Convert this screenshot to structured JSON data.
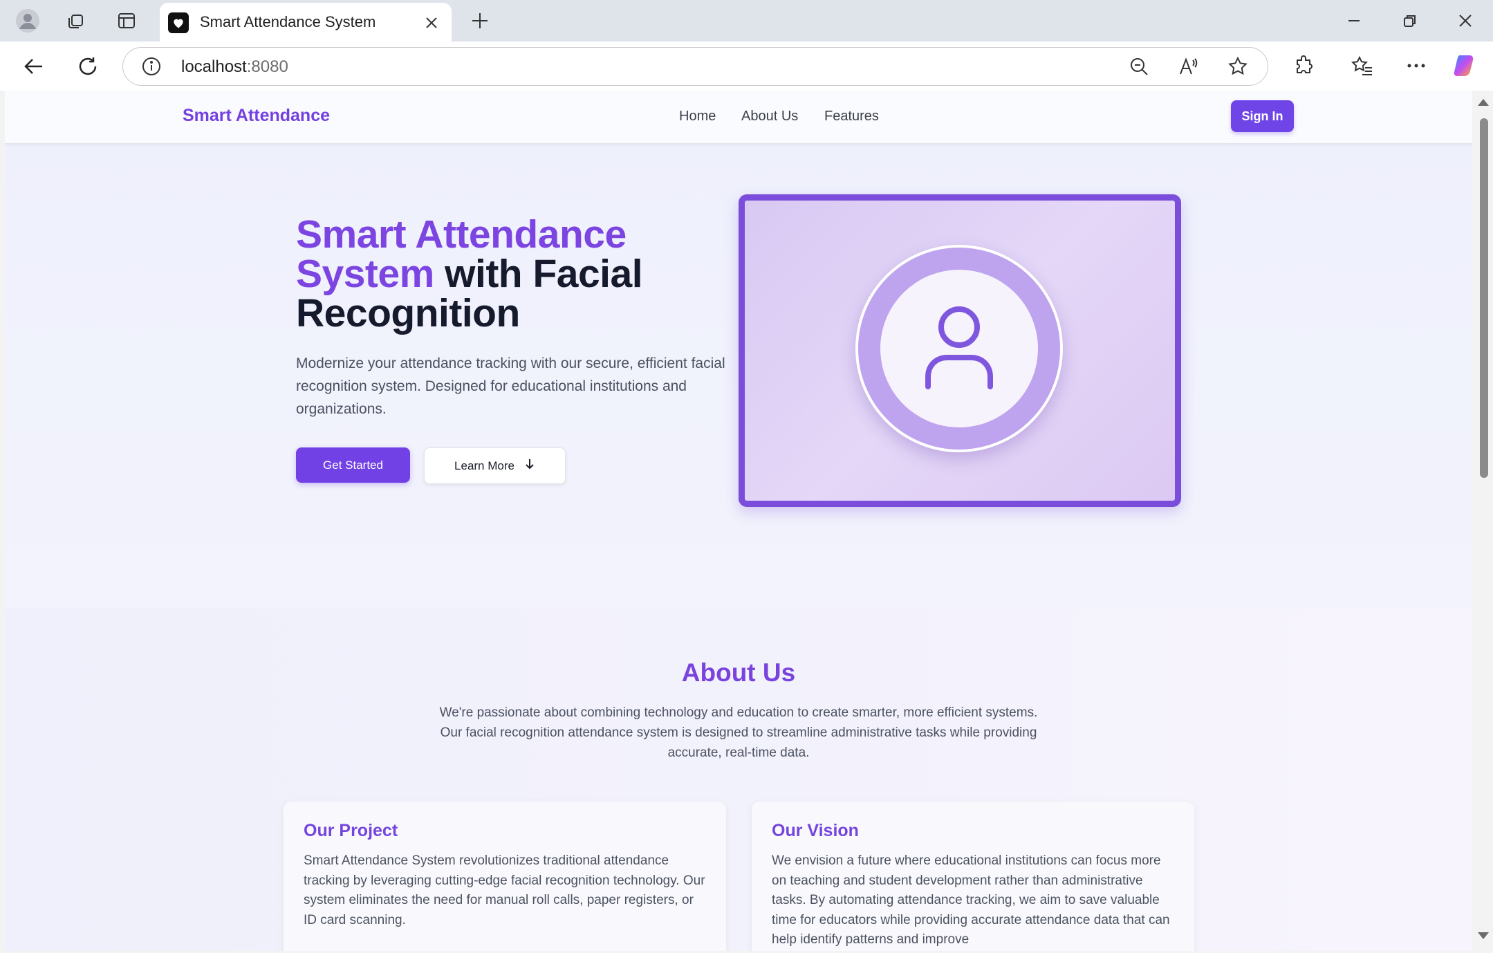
{
  "browser": {
    "tab_title": "Smart Attendance System",
    "url_host": "localhost",
    "url_port": ":8080"
  },
  "nav": {
    "brand": "Smart Attendance",
    "links": [
      "Home",
      "About Us",
      "Features"
    ],
    "signin": "Sign In"
  },
  "hero": {
    "title_accent": "Smart Attendance System",
    "title_rest": "with Facial Recognition",
    "description": "Modernize your attendance tracking with our secure, efficient facial recognition system. Designed for educational institutions and organizations.",
    "primary_button": "Get Started",
    "secondary_button": "Learn More"
  },
  "about": {
    "title": "About Us",
    "description": "We're passionate about combining technology and education to create smarter, more efficient systems. Our facial recognition attendance system is designed to streamline administrative tasks while providing accurate, real-time data.",
    "cards": [
      {
        "title": "Our Project",
        "text": "Smart Attendance System revolutionizes traditional attendance tracking by leveraging cutting-edge facial recognition technology. Our system eliminates the need for manual roll calls, paper registers, or ID card scanning."
      },
      {
        "title": "Our Vision",
        "text": "We envision a future where educational institutions can focus more on teaching and student development rather than administrative tasks. By automating attendance tracking, we aim to save valuable time for educators while providing accurate attendance data that can help identify patterns and improve"
      }
    ]
  },
  "colors": {
    "accent": "#7c45e2",
    "button": "#7141e6",
    "text_dark": "#151a2c"
  }
}
